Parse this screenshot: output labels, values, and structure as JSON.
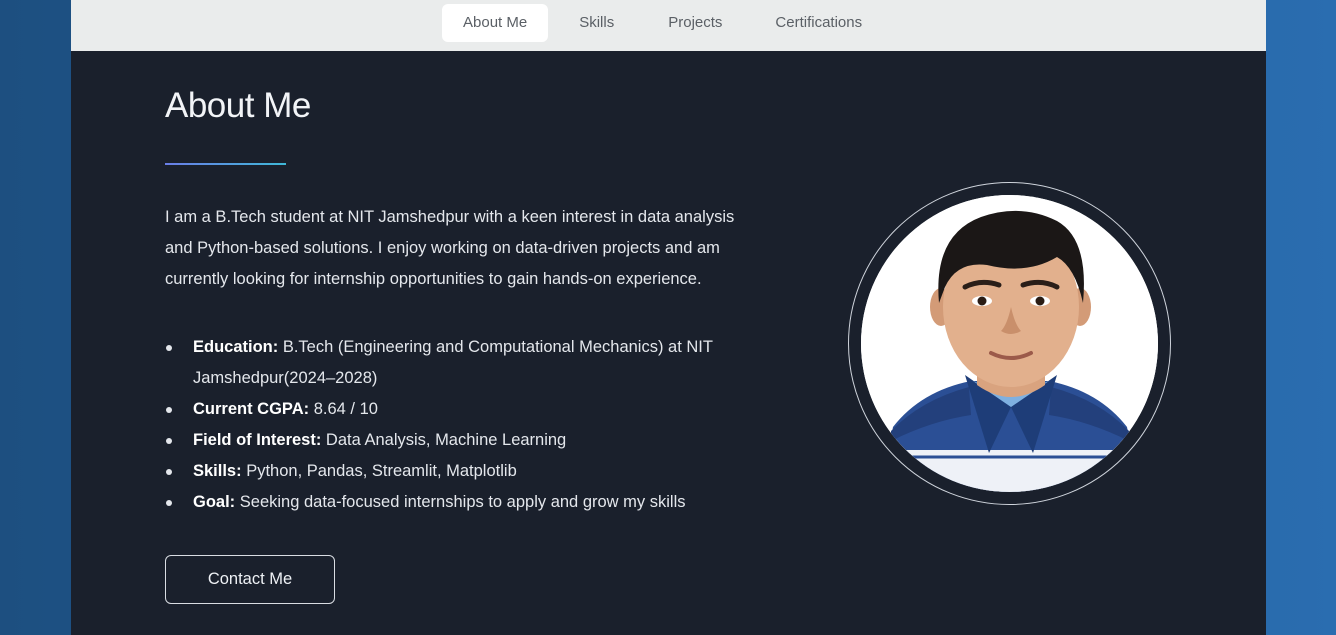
{
  "nav": {
    "tabs": [
      {
        "label": "About Me",
        "active": true
      },
      {
        "label": "Skills",
        "active": false
      },
      {
        "label": "Projects",
        "active": false
      },
      {
        "label": "Certifications",
        "active": false
      }
    ]
  },
  "about": {
    "title": "About Me",
    "intro": "I am a B.Tech student at NIT Jamshedpur with a keen interest in data analysis and Python-based solutions. I enjoy working on data-driven projects and am currently looking for internship opportunities to gain hands-on experience.",
    "facts": [
      {
        "key": "Education:",
        "value": " B.Tech (Engineering and Computational Mechanics) at NIT Jamshedpur(2024–2028)"
      },
      {
        "key": "Current CGPA:",
        "value": " 8.64 / 10"
      },
      {
        "key": "Field of Interest:",
        "value": " Data Analysis, Machine Learning"
      },
      {
        "key": "Skills:",
        "value": " Python, Pandas, Streamlit, Matplotlib"
      },
      {
        "key": "Goal:",
        "value": " Seeking data-focused internships to apply and grow my skills"
      }
    ],
    "contact_label": "Contact Me"
  },
  "colors": {
    "page_bg": "#1a202c",
    "nav_bg": "#eaecec",
    "accent_start": "#6a7ee8",
    "accent_end": "#3fb8d8"
  }
}
